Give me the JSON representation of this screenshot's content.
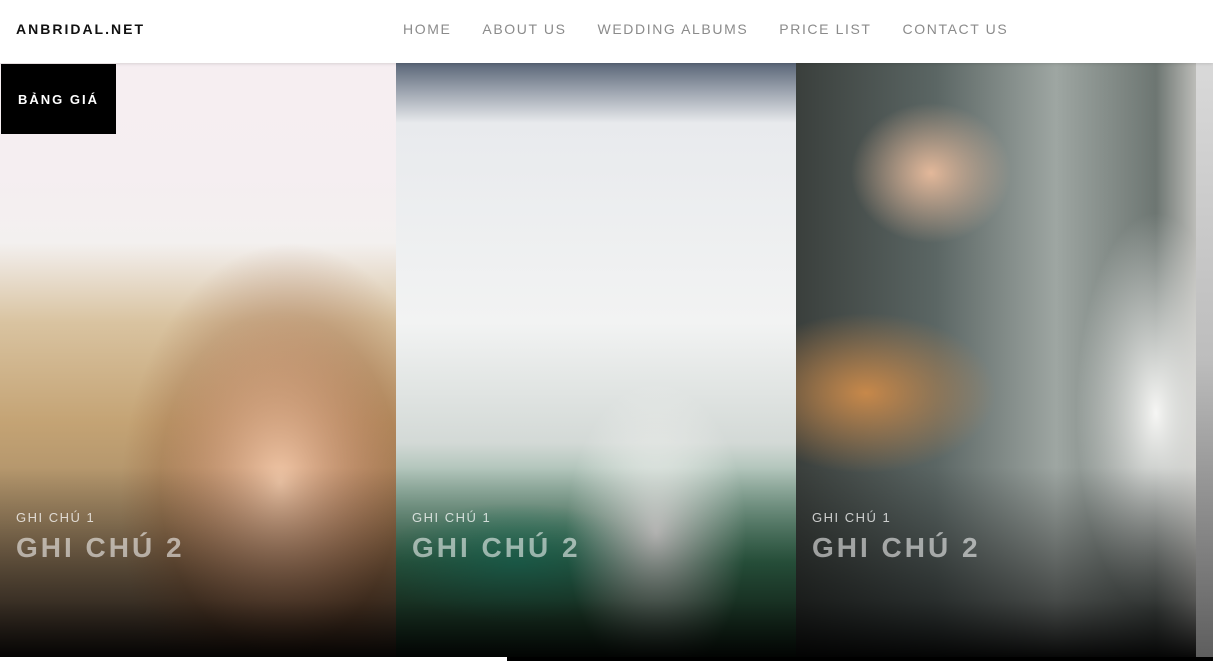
{
  "header": {
    "logo": "ANBRIDAL.NET",
    "nav": [
      "HOME",
      "ABOUT US",
      "WEDDING ALBUMS",
      "PRICE LIST",
      "CONTACT US"
    ]
  },
  "badge": {
    "label": "BẢNG GIÁ"
  },
  "panels": [
    {
      "note1": "GHI CHÚ 1",
      "note2": "GHI CHÚ 2"
    },
    {
      "note1": "GHI CHÚ 1",
      "note2": "GHI CHÚ 2"
    },
    {
      "note1": "GHI CHÚ 1",
      "note2": "GHI CHÚ 2"
    }
  ],
  "slider": {
    "progress": 0.418
  },
  "colors": {
    "nav_text": "#8b8b8b",
    "logo_text": "#111111",
    "badge_bg": "#000000"
  }
}
